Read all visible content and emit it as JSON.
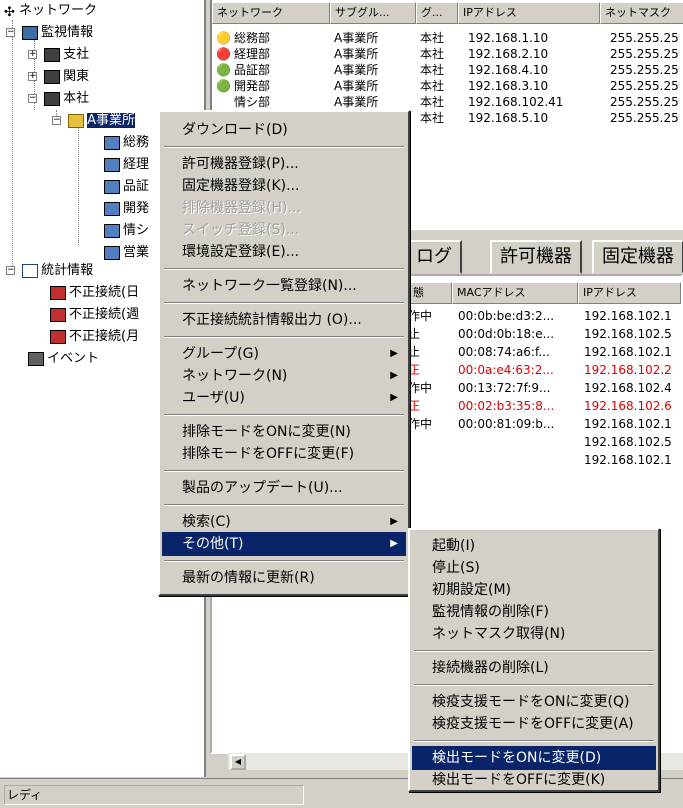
{
  "tree": {
    "root": "ネットワーク",
    "monitor": "監視情報",
    "branch1": "支社",
    "branch2": "関東",
    "head": "本社",
    "a_office": "A事業所",
    "children": [
      "総務",
      "経理",
      "品証",
      "開発",
      "情シ",
      "営業"
    ],
    "stats": "統計情報",
    "stat_items": [
      "不正接続(日",
      "不正接続(週",
      "不正接続(月"
    ],
    "event": "イベント"
  },
  "netlist": {
    "headers": [
      "ネットワーク",
      "サブグル...",
      "グ...",
      "IPアドレス",
      "ネットマスク"
    ],
    "rows": [
      {
        "name": "総務部",
        "sub": "A事業所",
        "grp": "本社",
        "ip": "192.168.1.10",
        "mask": "255.255.25"
      },
      {
        "name": "経理部",
        "sub": "A事業所",
        "grp": "本社",
        "ip": "192.168.2.10",
        "mask": "255.255.25"
      },
      {
        "name": "品証部",
        "sub": "A事業所",
        "grp": "本社",
        "ip": "192.168.4.10",
        "mask": "255.255.25"
      },
      {
        "name": "開発部",
        "sub": "A事業所",
        "grp": "本社",
        "ip": "192.168.3.10",
        "mask": "255.255.25"
      },
      {
        "name": "情シ部",
        "sub": "A事業所",
        "grp": "本社",
        "ip": "192.168.102.41",
        "mask": "255.255.25"
      },
      {
        "name": "",
        "sub": "",
        "grp": "本社",
        "ip": "192.168.5.10",
        "mask": "255.255.25"
      }
    ]
  },
  "tabs": [
    "ログ",
    "許可機器",
    "固定機器"
  ],
  "loglist": {
    "headers": [
      "態",
      "MACアドレス",
      "IPアドレス"
    ],
    "rows": [
      {
        "st": "作中",
        "mac": "00:0b:be:d3:2...",
        "ip": "192.168.102.1",
        "red": false
      },
      {
        "st": "止",
        "mac": "00:0d:0b:18:e...",
        "ip": "192.168.102.5",
        "red": false
      },
      {
        "st": "止",
        "mac": "00:08:74:a6:f...",
        "ip": "192.168.102.1",
        "red": false
      },
      {
        "st": "正",
        "mac": "00:0a:e4:63:2...",
        "ip": "192.168.102.2",
        "red": true
      },
      {
        "st": "作中",
        "mac": "00:13:72:7f:9...",
        "ip": "192.168.102.4",
        "red": false
      },
      {
        "st": "正",
        "mac": "00:02:b3:35:8...",
        "ip": "192.168.102.6",
        "red": true
      },
      {
        "st": "作中",
        "mac": "00:00:81:09:b...",
        "ip": "192.168.102.1",
        "red": false
      },
      {
        "st": "",
        "mac": "",
        "ip": "192.168.102.5",
        "red": false
      },
      {
        "st": "",
        "mac": "",
        "ip": "192.168.102.1",
        "red": false
      }
    ]
  },
  "menu": {
    "download": "ダウンロード(D)",
    "permit_reg": "許可機器登録(P)...",
    "fixed_reg": "固定機器登録(K)...",
    "exclude_reg": "排除機器登録(H)...",
    "switch_reg": "スイッチ登録(S)...",
    "env_reg": "環境設定登録(E)...",
    "netlist_reg": "ネットワーク一覧登録(N)...",
    "stats_out": "不正接続統計情報出力 (O)...",
    "group": "グループ(G)",
    "network": "ネットワーク(N)",
    "user": "ユーザ(U)",
    "exclude_on": "排除モードをONに変更(N)",
    "exclude_off": "排除モードをOFFに変更(F)",
    "update": "製品のアップデート(U)...",
    "search": "検索(C)",
    "other": "その他(T)",
    "refresh": "最新の情報に更新(R)"
  },
  "submenu": {
    "start": "起動(I)",
    "stop": "停止(S)",
    "init": "初期設定(M)",
    "del_monitor": "監視情報の削除(F)",
    "netmask": "ネットマスク取得(N)",
    "del_conn": "接続機器の削除(L)",
    "quarantine_on": "検疫支援モードをONに変更(Q)",
    "quarantine_off": "検疫支援モードをOFFに変更(A)",
    "detect_on": "検出モードをONに変更(D)",
    "detect_off": "検出モードをOFFに変更(K)"
  },
  "status": "レディ",
  "colors": {
    "selection": "#0a246a",
    "alert": "#e00000",
    "face": "#d4d0c8"
  }
}
